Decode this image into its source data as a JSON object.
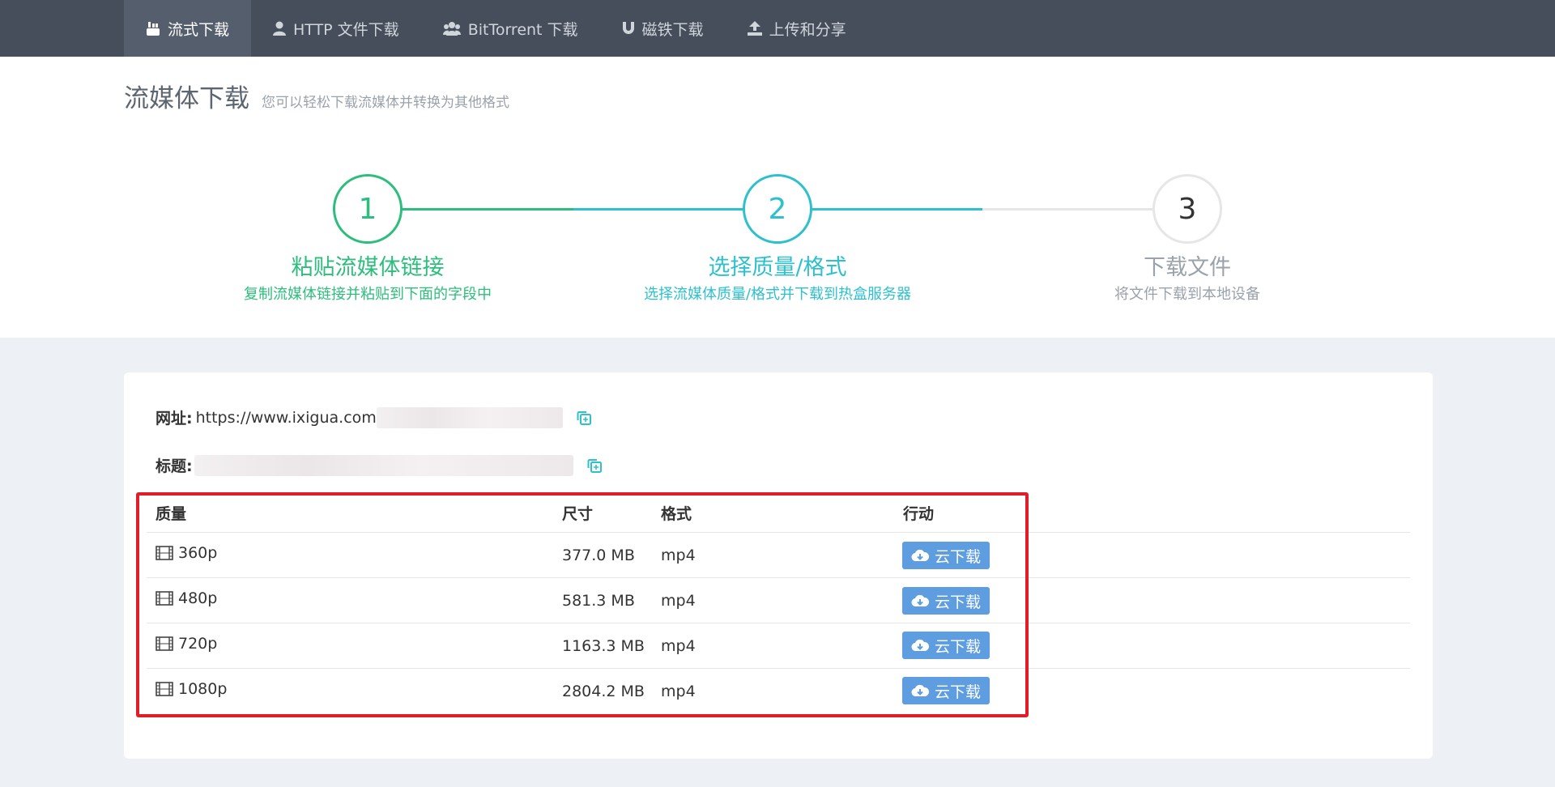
{
  "nav": {
    "items": [
      {
        "label": "流式下载",
        "icon": "youtube-icon",
        "active": true
      },
      {
        "label": "HTTP 文件下载",
        "icon": "user-icon"
      },
      {
        "label": "BitTorrent 下载",
        "icon": "users-icon"
      },
      {
        "label": "磁铁下载",
        "icon": "magnet-icon"
      },
      {
        "label": "上传和分享",
        "icon": "upload-icon"
      }
    ]
  },
  "header": {
    "title": "流媒体下载",
    "subtitle": "您可以轻松下载流媒体并转换为其他格式"
  },
  "steps": [
    {
      "number": "1",
      "title": "粘贴流媒体链接",
      "desc": "复制流媒体链接并粘贴到下面的字段中",
      "color": "#2dbd7c"
    },
    {
      "number": "2",
      "title": "选择质量/格式",
      "desc": "选择流媒体质量/格式并下载到热盒服务器",
      "color": "#2ec0cc"
    },
    {
      "number": "3",
      "title": "下载文件",
      "desc": "将文件下载到本地设备",
      "color": "#9aa2ab"
    }
  ],
  "info": {
    "url_label": "网址:",
    "url_value": "https://www.ixigua.com",
    "title_label": "标题:"
  },
  "table": {
    "headers": {
      "quality": "质量",
      "size": "尺寸",
      "format": "格式",
      "action": "行动"
    },
    "rows": [
      {
        "quality": "360p",
        "size": "377.0 MB",
        "format": "mp4",
        "action": "云下载"
      },
      {
        "quality": "480p",
        "size": "581.3 MB",
        "format": "mp4",
        "action": "云下载"
      },
      {
        "quality": "720p",
        "size": "1163.3 MB",
        "format": "mp4",
        "action": "云下载"
      },
      {
        "quality": "1080p",
        "size": "2804.2 MB",
        "format": "mp4",
        "action": "云下载"
      }
    ]
  },
  "colors": {
    "nav_bg": "#464e5b",
    "step1": "#2dbd7c",
    "step2": "#2ec0cc",
    "button": "#5e9de0",
    "highlight": "#e01e2a"
  }
}
